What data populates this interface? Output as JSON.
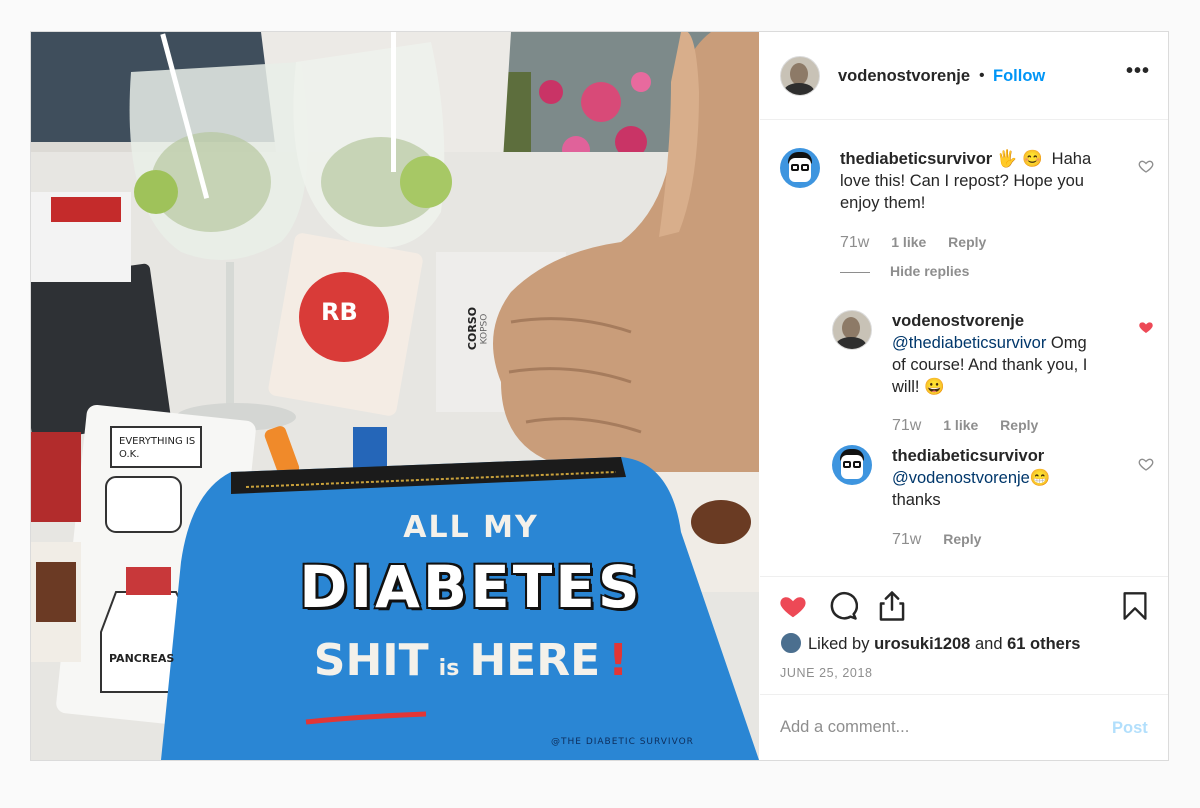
{
  "post": {
    "username": "vodenostvorenje",
    "separator": "•",
    "follow_label": "Follow",
    "more_label": "•••",
    "photo": {
      "bag_line1": "ALL MY",
      "bag_line2": "DIABETES",
      "bag_line3_a": "SHIT",
      "bag_line3_small": "is",
      "bag_line3_b": "HERE",
      "bag_line3_bang": "!",
      "bag_footer": "@THE DIABETIC SURVIVOR",
      "sticker1": "EVERYTHING IS O.K.",
      "sticker2": "PANCREAS",
      "sticker_rb": "RB",
      "book_title": "CORSO",
      "book_sub": "KOPSO"
    },
    "comments": [
      {
        "user": "thediabeticsurvivor",
        "emoji": "🖐 😊",
        "text_l1": "Haha",
        "text_l2": "love this! Can I repost? Hope you",
        "text_l3": "enjoy them!",
        "age": "71w",
        "likes": "1 like",
        "reply": "Reply",
        "hide_replies": "Hide replies",
        "liked": false
      },
      {
        "user": "vodenostvorenje",
        "mention": "@thediabeticsurvivor",
        "text_l1": "Omg",
        "text_l2": "of course! And thank you, I",
        "text_l3": "will! 😀",
        "age": "71w",
        "likes": "1 like",
        "reply": "Reply",
        "liked": true
      },
      {
        "user": "thediabeticsurvivor",
        "mention": "@vodenostvorenje😁",
        "text_l3": "thanks",
        "age": "71w",
        "reply": "Reply",
        "liked": false
      }
    ],
    "liked_by_prefix": "Liked by",
    "liked_by_user": "urosuki1208",
    "liked_by_and": "and",
    "liked_by_others": "61 others",
    "date": "JUNE 25, 2018",
    "add_comment_placeholder": "Add a comment...",
    "post_label": "Post",
    "colors": {
      "accent": "#0095f6",
      "like_red": "#ed4956",
      "muted": "#8e8e8e",
      "bag_blue": "#2a86d4"
    }
  }
}
